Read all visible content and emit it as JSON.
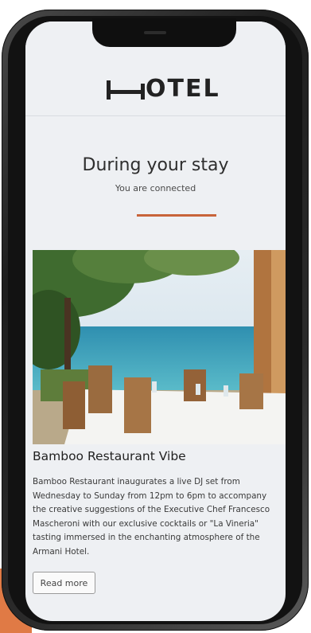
{
  "header": {
    "logo_text": "OTEL"
  },
  "hero": {
    "title": "During your stay",
    "subtitle": "You are connected"
  },
  "article": {
    "title": "Bamboo Restaurant Vibe",
    "body": "Bamboo Restaurant inaugurates a live DJ set from Wednesday to Sunday from 12pm to 6pm to accompany the creative suggestions of the Executive Chef Francesco Mascheroni with our exclusive cocktails or \"La Vineria\" tasting immersed in the enchanting atmosphere of the Armani Hotel.",
    "button_label": "Read more"
  },
  "colors": {
    "accent": "#c8643a",
    "background": "#eef0f3",
    "corner_block": "#e07a45"
  }
}
